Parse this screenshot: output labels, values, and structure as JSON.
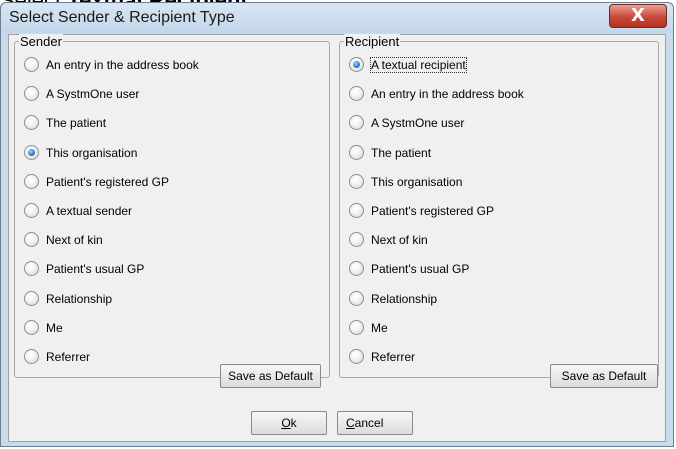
{
  "caption": {
    "prefix": "Select ",
    "bold": "Textual Recipient"
  },
  "window": {
    "title": "Select Sender & Recipient Type",
    "close_glyph": "X"
  },
  "sender": {
    "legend": "Sender",
    "options": [
      {
        "label": "An entry in the address book",
        "checked": false
      },
      {
        "label": "A SystmOne user",
        "checked": false
      },
      {
        "label": "The patient",
        "checked": false
      },
      {
        "label": "This organisation",
        "checked": true
      },
      {
        "label": "Patient's registered GP",
        "checked": false
      },
      {
        "label": "A textual sender",
        "checked": false
      },
      {
        "label": "Next of kin",
        "checked": false
      },
      {
        "label": "Patient's usual GP",
        "checked": false
      },
      {
        "label": "Relationship",
        "checked": false
      },
      {
        "label": "Me",
        "checked": false
      },
      {
        "label": "Referrer",
        "checked": false
      }
    ],
    "save_default_label": "Save as Default"
  },
  "recipient": {
    "legend": "Recipient",
    "options": [
      {
        "label": "A textual recipient",
        "checked": true
      },
      {
        "label": "An entry in the address book",
        "checked": false
      },
      {
        "label": "A SystmOne user",
        "checked": false
      },
      {
        "label": "The patient",
        "checked": false
      },
      {
        "label": "This organisation",
        "checked": false
      },
      {
        "label": "Patient's registered GP",
        "checked": false
      },
      {
        "label": "Next of kin",
        "checked": false
      },
      {
        "label": "Patient's usual GP",
        "checked": false
      },
      {
        "label": "Relationship",
        "checked": false
      },
      {
        "label": "Me",
        "checked": false
      },
      {
        "label": "Referrer",
        "checked": false
      }
    ],
    "save_default_label": "Save as Default"
  },
  "buttons": {
    "ok_label": "Ok",
    "cancel_label": "Cancel"
  }
}
